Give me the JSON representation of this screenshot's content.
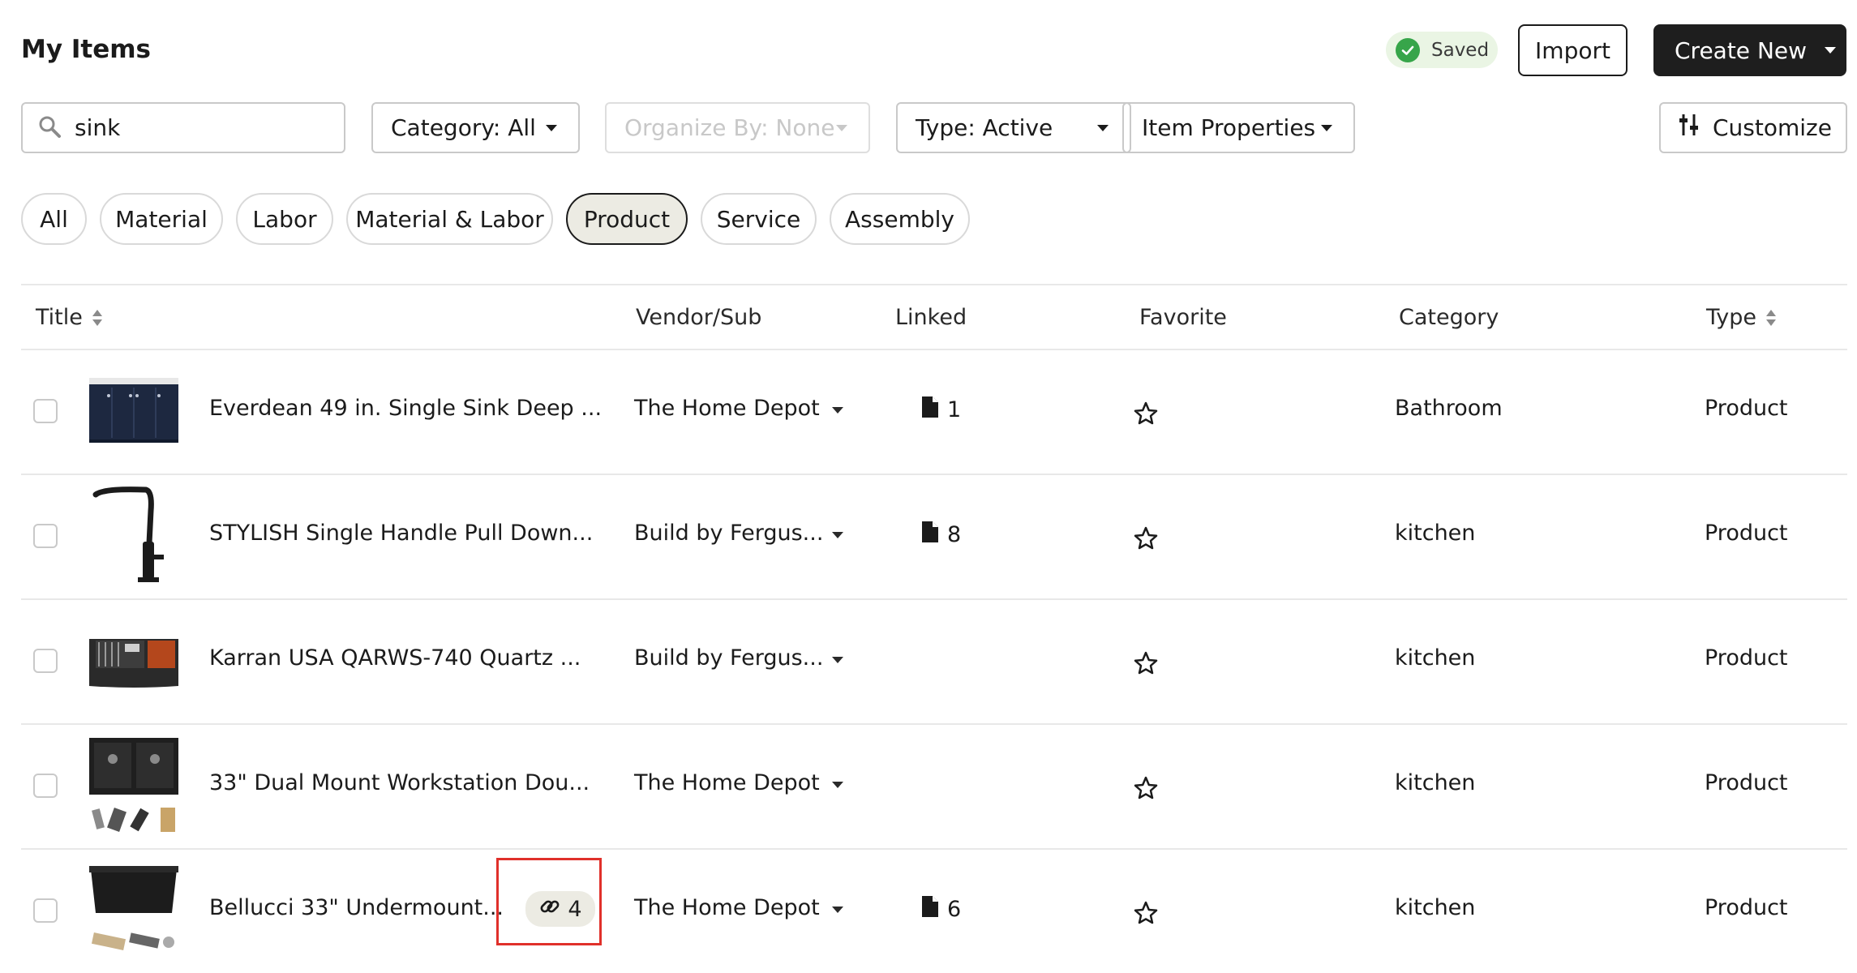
{
  "header": {
    "title": "My Items",
    "saved_label": "Saved",
    "import_label": "Import",
    "create_label": "Create New"
  },
  "filters": {
    "search_value": "sink",
    "category": "Category: All",
    "organize": "Organize By: None",
    "type": "Type: Active",
    "properties": "Item Properties",
    "customize": "Customize"
  },
  "chips": [
    "All",
    "Material",
    "Labor",
    "Material & Labor",
    "Product",
    "Service",
    "Assembly"
  ],
  "active_chip": "Product",
  "columns": {
    "title": "Title",
    "vendor": "Vendor/Sub",
    "linked": "Linked",
    "favorite": "Favorite",
    "category": "Category",
    "type": "Type"
  },
  "rows": [
    {
      "title": "Everdean 49 in. Single Sink Deep ...",
      "vendor": "The Home Depot",
      "linked": "1",
      "category": "Bathroom",
      "type": "Product"
    },
    {
      "title": "STYLISH Single Handle Pull Down...",
      "vendor": "Build by Fergus...",
      "linked": "8",
      "category": "kitchen",
      "type": "Product"
    },
    {
      "title": "Karran USA QARWS-740 Quartz ...",
      "vendor": "Build by Fergus...",
      "linked": "",
      "category": "kitchen",
      "type": "Product"
    },
    {
      "title": "33\" Dual Mount Workstation Dou...",
      "vendor": "The Home Depot",
      "linked": "",
      "category": "kitchen",
      "type": "Product"
    },
    {
      "title": "Bellucci 33\" Undermount...",
      "vendor": "The Home Depot",
      "linked": "6",
      "category": "kitchen",
      "type": "Product",
      "link_count": "4"
    }
  ],
  "colors": {
    "accent_dark": "#1e1e1e",
    "saved_green": "#37a54a",
    "chip_active_bg": "#ecebe3",
    "highlight_red": "#e0302a"
  }
}
